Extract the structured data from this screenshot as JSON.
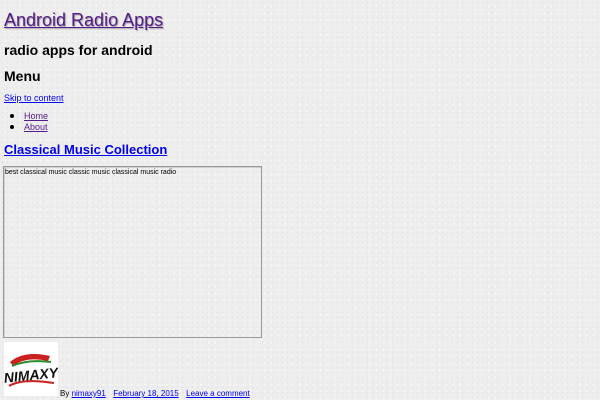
{
  "site": {
    "title": "Android Radio Apps",
    "description": "radio apps for android"
  },
  "menu": {
    "toggle_label": "Menu",
    "skip_link": "Skip to content",
    "items": [
      {
        "label": "Home"
      },
      {
        "label": "About"
      }
    ]
  },
  "post": {
    "title": "Classical Music Collection",
    "embed_text": "best classical music classic music classical music radio",
    "author_avatar_text": "NIMAXY",
    "by_label": "By",
    "author": "nimaxy91",
    "date": "February 18, 2015",
    "comment_link": "Leave a comment"
  },
  "colors": {
    "link": "#0000ee",
    "visited_link": "#551a8b",
    "background": "#eeeeee",
    "logo_red": "#cc1f1f",
    "logo_green": "#2e8b2e"
  }
}
